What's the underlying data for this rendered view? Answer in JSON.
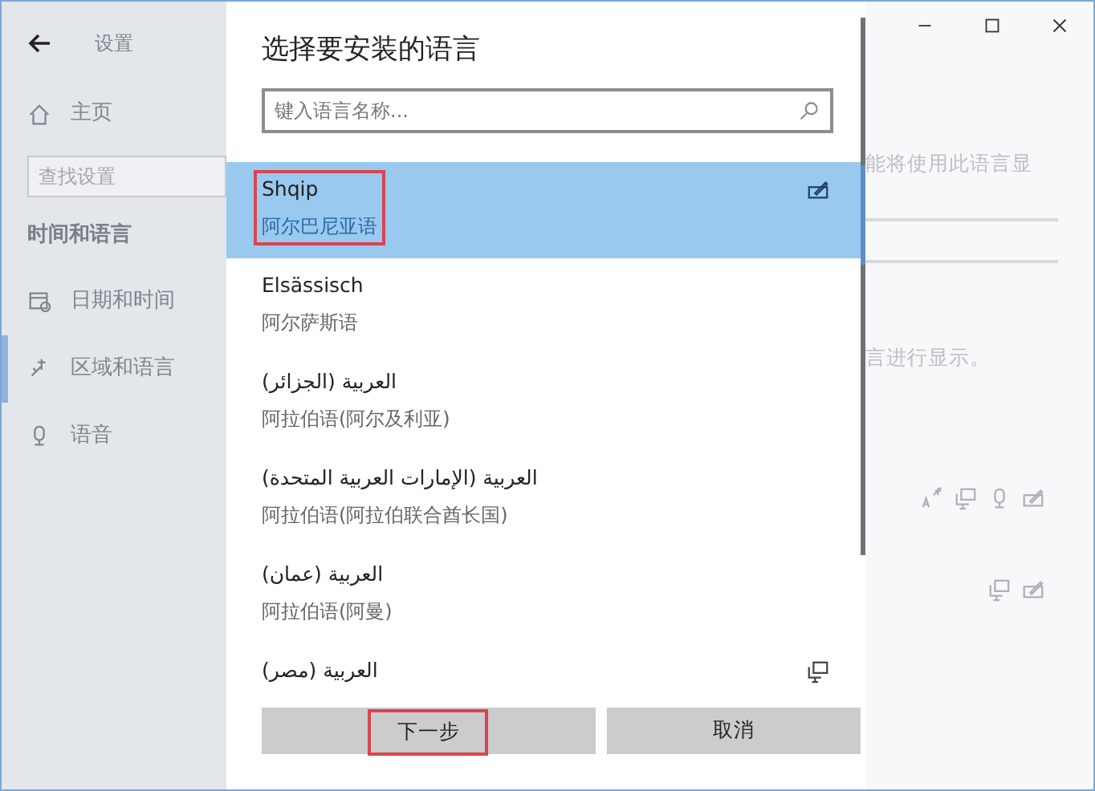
{
  "settings_window": {
    "title": "设置",
    "home": "主页",
    "search": {
      "placeholder": "查找设置"
    },
    "section_heading": "时间和语言",
    "nav_items": [
      {
        "label": "日期和时间",
        "kind": "calendar",
        "selected": false
      },
      {
        "label": "区域和语言",
        "kind": "region",
        "selected": true
      },
      {
        "label": "语音",
        "kind": "speech",
        "selected": false
      }
    ],
    "content": {
      "texts": [
        "能将使用此语言显",
        "言进行显示。"
      ],
      "feature_rows": [
        {
          "icons": [
            {
              "kind": "tts"
            },
            {
              "kind": "display"
            },
            {
              "kind": "speech"
            },
            {
              "kind": "handwriting"
            }
          ]
        },
        {
          "icons": [
            {
              "kind": "display"
            },
            {
              "kind": "handwriting"
            }
          ]
        }
      ]
    }
  },
  "dialog": {
    "title": "选择要安装的语言",
    "search": {
      "placeholder": "键入语言名称..."
    },
    "languages": [
      {
        "name": "Shqip",
        "description": "阿尔巴尼亚语",
        "selected": true,
        "annotated": true,
        "features": [
          {
            "kind": "handwriting"
          }
        ]
      },
      {
        "name": "Elsässisch",
        "description": "阿尔萨斯语",
        "selected": false,
        "annotated": false
      },
      {
        "name": "العربية (الجزائر)",
        "description": "阿拉伯语(阿尔及利亚)",
        "selected": false,
        "annotated": false
      },
      {
        "name": "العربية (الإمارات العربية المتحدة)",
        "description": "阿拉伯语(阿拉伯联合酋长国)",
        "selected": false,
        "annotated": false
      },
      {
        "name": "العربية (عمان)",
        "description": "阿拉伯语(阿曼)",
        "selected": false,
        "annotated": false
      },
      {
        "name": "العربية (مصر)",
        "selected": false,
        "annotated": false,
        "features": [
          {
            "kind": "display"
          }
        ]
      }
    ],
    "buttons": [
      {
        "label": "下一步",
        "annotated": true
      },
      {
        "label": "取消",
        "annotated": false
      }
    ]
  }
}
